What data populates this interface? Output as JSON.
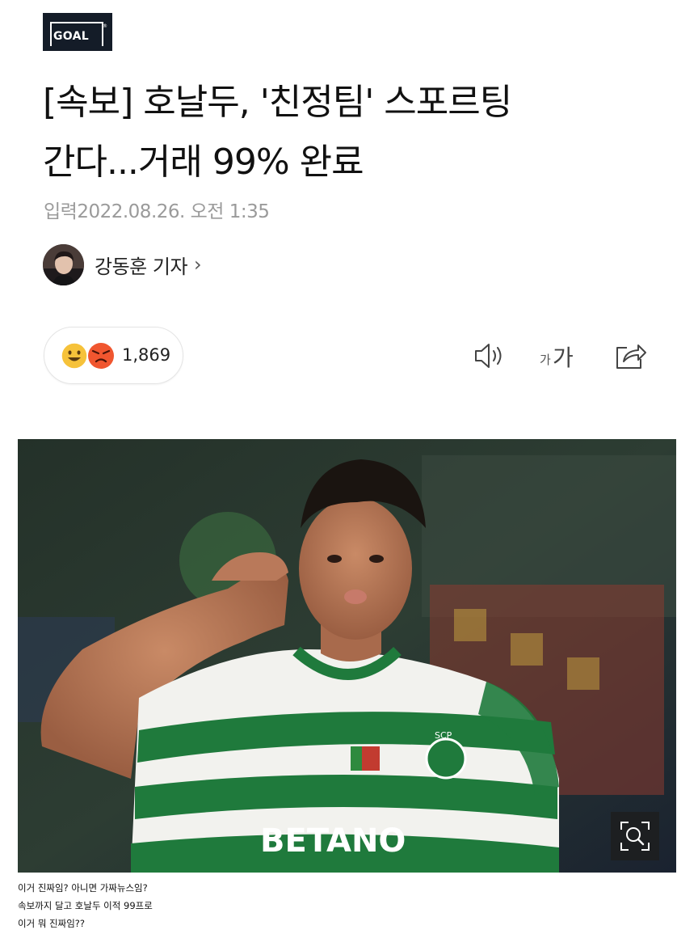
{
  "brand": {
    "logo_text": "GOAL"
  },
  "article": {
    "title_line1": "[속보] 호날두, '친정팀' 스포르팅",
    "title_line2": "간다...거래 99% 완료",
    "date_label": "입력",
    "date_value": "2022.08.26. 오전 1:35",
    "author": "강동훈 기자",
    "author_chevron": "›"
  },
  "reactions": {
    "count": "1,869",
    "icons": [
      "happy-face-icon",
      "angry-face-icon"
    ]
  },
  "toolbar": {
    "icons": [
      "speaker-icon",
      "font-size-icon",
      "share-icon"
    ],
    "font_small": "가",
    "font_large": "가"
  },
  "photo": {
    "shirt_sponsor": "BETANO",
    "badge_text": "SCP",
    "zoom_icon": "zoom-icon"
  },
  "caption": {
    "line1": "이거 진짜임? 아니면 가짜뉴스임?",
    "line2": "속보까지 달고 호날두 이적 99프로",
    "line3": "이거 뭐 진짜임??"
  },
  "colors": {
    "logo_bg": "#141c28",
    "happy": "#f6c23a",
    "angry": "#f0562f",
    "jersey_green": "#1f7a3c"
  }
}
